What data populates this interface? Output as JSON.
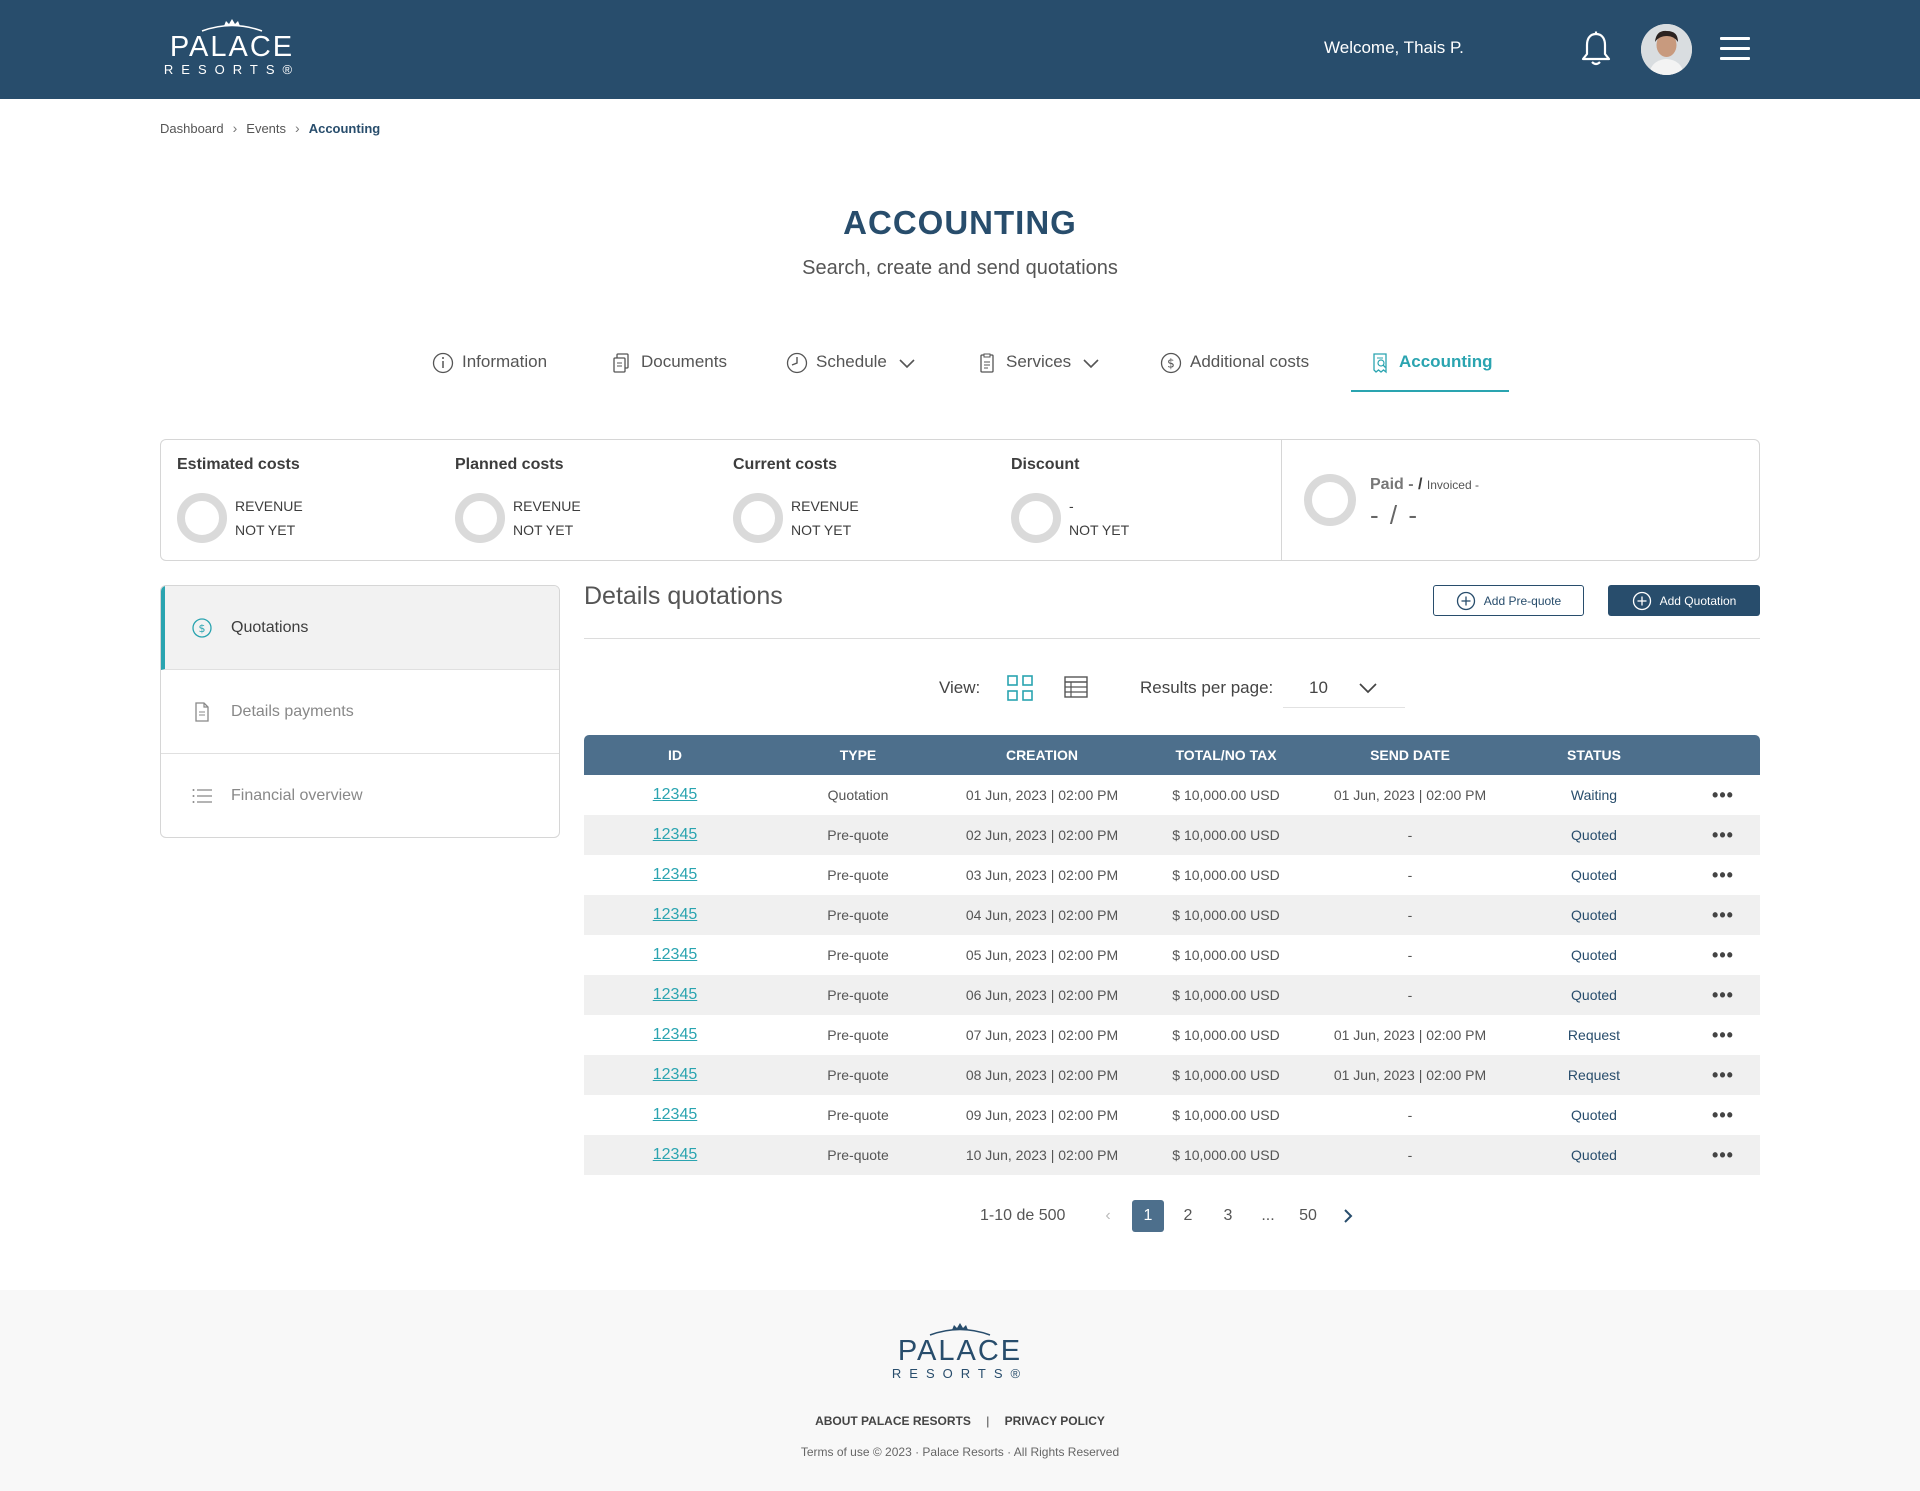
{
  "header": {
    "logo_word": "PALACE",
    "logo_sub": "RESORTS®",
    "welcome": "Welcome, Thais P.",
    "icons": [
      "bell-icon",
      "avatar",
      "hamburger-menu-icon"
    ]
  },
  "breadcrumb": {
    "items": [
      "Dashboard",
      "Events",
      "Accounting"
    ]
  },
  "page": {
    "title": "ACCOUNTING",
    "subtitle": "Search, create and send quotations"
  },
  "tabs": [
    {
      "label": "Information",
      "icon": "info-icon"
    },
    {
      "label": "Documents",
      "icon": "documents-icon"
    },
    {
      "label": "Schedule",
      "icon": "clock-icon"
    },
    {
      "label": "Services",
      "icon": "clipboard-icon"
    },
    {
      "label": "Additional costs",
      "icon": "dollar-circle-icon"
    },
    {
      "label": "Accounting",
      "icon": "receipt-icon",
      "active": true
    }
  ],
  "costs": [
    {
      "label": "Estimated costs",
      "line1": "REVENUE",
      "line2": "NOT YET"
    },
    {
      "label": "Planned costs",
      "line1": "REVENUE",
      "line2": "NOT YET"
    },
    {
      "label": "Current costs",
      "line1": "REVENUE",
      "line2": "NOT YET"
    },
    {
      "label": "Discount",
      "line1": "-",
      "line2": "NOT YET"
    }
  ],
  "paid": {
    "paid_label": "Paid -",
    "slash": "/",
    "invoiced_label": "Invoiced -",
    "value": "- / -"
  },
  "side_menu": [
    {
      "label": "Quotations",
      "icon": "dollar-circle-icon",
      "active": true
    },
    {
      "label": "Details payments",
      "icon": "document-icon"
    },
    {
      "label": "Financial overview",
      "icon": "list-icon"
    }
  ],
  "details": {
    "title": "Details quotations",
    "add_prequote": "Add Pre-quote",
    "add_quotation": "Add Quotation",
    "view_label": "View:",
    "rpp_label": "Results per page:",
    "rpp_value": "10"
  },
  "table": {
    "columns": [
      "ID",
      "TYPE",
      "CREATION",
      "TOTAL/NO TAX",
      "SEND DATE",
      "STATUS",
      ""
    ],
    "rows": [
      {
        "id": "12345",
        "type": "Quotation",
        "creation": "01 Jun, 2023 | 02:00 PM",
        "total": "$ 10,000.00 USD",
        "send": "01 Jun, 2023 | 02:00 PM",
        "status": "Waiting",
        "more": "•••"
      },
      {
        "id": "12345",
        "type": "Pre-quote",
        "creation": "02 Jun, 2023 | 02:00 PM",
        "total": "$ 10,000.00 USD",
        "send": "-",
        "status": "Quoted",
        "more": "•••"
      },
      {
        "id": "12345",
        "type": "Pre-quote",
        "creation": "03 Jun, 2023 | 02:00 PM",
        "total": "$ 10,000.00 USD",
        "send": "-",
        "status": "Quoted",
        "more": "•••"
      },
      {
        "id": "12345",
        "type": "Pre-quote",
        "creation": "04 Jun, 2023 | 02:00 PM",
        "total": "$ 10,000.00 USD",
        "send": "-",
        "status": "Quoted",
        "more": "•••"
      },
      {
        "id": "12345",
        "type": "Pre-quote",
        "creation": "05 Jun, 2023 | 02:00 PM",
        "total": "$ 10,000.00 USD",
        "send": "-",
        "status": "Quoted",
        "more": "•••"
      },
      {
        "id": "12345",
        "type": "Pre-quote",
        "creation": "06 Jun, 2023 | 02:00 PM",
        "total": "$ 10,000.00 USD",
        "send": "-",
        "status": "Quoted",
        "more": "•••"
      },
      {
        "id": "12345",
        "type": "Pre-quote",
        "creation": "07 Jun, 2023 | 02:00 PM",
        "total": "$ 10,000.00 USD",
        "send": "01 Jun, 2023 | 02:00 PM",
        "status": "Request",
        "more": "•••"
      },
      {
        "id": "12345",
        "type": "Pre-quote",
        "creation": "08 Jun, 2023 | 02:00 PM",
        "total": "$ 10,000.00 USD",
        "send": "01 Jun, 2023 | 02:00 PM",
        "status": "Request",
        "more": "•••"
      },
      {
        "id": "12345",
        "type": "Pre-quote",
        "creation": "09 Jun, 2023 | 02:00 PM",
        "total": "$ 10,000.00 USD",
        "send": "-",
        "status": "Quoted",
        "more": "•••"
      },
      {
        "id": "12345",
        "type": "Pre-quote",
        "creation": "10 Jun, 2023 | 02:00 PM",
        "total": "$ 10,000.00 USD",
        "send": "-",
        "status": "Quoted",
        "more": "•••"
      }
    ]
  },
  "pagination": {
    "range": "1-10 de 500",
    "prev": "‹",
    "pages": [
      "1",
      "2",
      "3",
      "...",
      "50"
    ],
    "current": "1"
  },
  "footer": {
    "logo_word": "PALACE",
    "logo_sub": "RESORTS®",
    "link_about": "ABOUT PALACE RESORTS",
    "link_sep": "|",
    "link_privacy": "PRIVACY POLICY",
    "copyright": "Terms of use © 2023 · Palace Resorts · All Rights Reserved"
  },
  "colors": {
    "brand_navy": "#284d6c",
    "table_header": "#4d6f8c",
    "accent_teal": "#2aa4b0"
  }
}
